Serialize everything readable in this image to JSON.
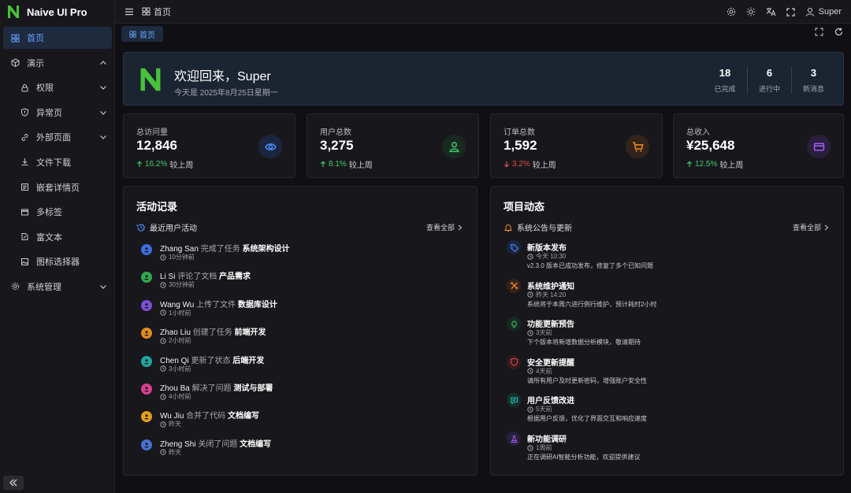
{
  "app": {
    "title": "Naive UI Pro"
  },
  "sidebar": {
    "items": [
      {
        "label": "首页",
        "icon": "dashboard-icon",
        "active": true,
        "sub": false
      },
      {
        "label": "演示",
        "icon": "cube-icon",
        "active": false,
        "sub": false,
        "chevron": "up"
      },
      {
        "label": "权限",
        "icon": "lock-icon",
        "active": false,
        "sub": true,
        "chevron": "down"
      },
      {
        "label": "异常页",
        "icon": "shield-alert-icon",
        "active": false,
        "sub": true,
        "chevron": "down"
      },
      {
        "label": "外部页面",
        "icon": "link-icon",
        "active": false,
        "sub": true,
        "chevron": "down"
      },
      {
        "label": "文件下载",
        "icon": "download-icon",
        "active": false,
        "sub": true
      },
      {
        "label": "嵌套详情页",
        "icon": "document-icon",
        "active": false,
        "sub": true
      },
      {
        "label": "多标签",
        "icon": "window-icon",
        "active": false,
        "sub": true
      },
      {
        "label": "富文本",
        "icon": "file-edit-icon",
        "active": false,
        "sub": true
      },
      {
        "label": "图标选择器",
        "icon": "image-icon",
        "active": false,
        "sub": true
      },
      {
        "label": "系统管理",
        "icon": "gear-icon",
        "active": false,
        "sub": false,
        "chevron": "down"
      }
    ]
  },
  "header": {
    "breadcrumb": "首页",
    "user": "Super"
  },
  "tabs": [
    {
      "label": "首页"
    }
  ],
  "welcome": {
    "title": "欢迎回来，Super",
    "subtitle": "今天是 2025年8月25日星期一",
    "stats": [
      {
        "value": "18",
        "label": "已完成"
      },
      {
        "value": "6",
        "label": "进行中"
      },
      {
        "value": "3",
        "label": "新消息"
      }
    ]
  },
  "stats": [
    {
      "label": "总访问量",
      "value": "12,846",
      "change": "16.2%",
      "direction": "up",
      "suffix": "较上周",
      "icon": "eye-icon",
      "color": "#4c8dff",
      "bg": "#1c2540"
    },
    {
      "label": "用户总数",
      "value": "3,275",
      "change": "8.1%",
      "direction": "up",
      "suffix": "较上周",
      "icon": "user-icon",
      "color": "#3fca6a",
      "bg": "#182a20"
    },
    {
      "label": "订单总数",
      "value": "1,592",
      "change": "3.2%",
      "direction": "down",
      "suffix": "较上周",
      "icon": "cart-icon",
      "color": "#f08a24",
      "bg": "#34231a"
    },
    {
      "label": "总收入",
      "value": "¥25,648",
      "change": "12.5%",
      "direction": "up",
      "suffix": "较上周",
      "icon": "card-icon",
      "color": "#a05cf0",
      "bg": "#2a1f3c"
    }
  ],
  "activity": {
    "title": "活动记录",
    "subtitle": "最近用户活动",
    "view_all": "查看全部",
    "items": [
      {
        "name": "Zhang San",
        "action": "完成了任务",
        "target": "系统架构设计",
        "time": "10分钟前",
        "color": "#3b6fe0"
      },
      {
        "name": "Li Si",
        "action": "评论了文档",
        "target": "产品需求",
        "time": "30分钟前",
        "color": "#2fa84f"
      },
      {
        "name": "Wang Wu",
        "action": "上传了文件",
        "target": "数据库设计",
        "time": "1小时前",
        "color": "#7a4fd6"
      },
      {
        "name": "Zhao Liu",
        "action": "创建了任务",
        "target": "前端开发",
        "time": "2小时前",
        "color": "#e08a1e"
      },
      {
        "name": "Chen Qi",
        "action": "更新了状态",
        "target": "后端开发",
        "time": "3小时前",
        "color": "#1fa6a0"
      },
      {
        "name": "Zhou Ba",
        "action": "解决了问题",
        "target": "测试与部署",
        "time": "4小时前",
        "color": "#d63f8e"
      },
      {
        "name": "Wu Jiu",
        "action": "合并了代码",
        "target": "文档编写",
        "time": "昨天",
        "color": "#e0a01e"
      },
      {
        "name": "Zheng Shi",
        "action": "关闭了问题",
        "target": "文档编写",
        "time": "昨天",
        "color": "#4a6fd0"
      }
    ]
  },
  "news": {
    "title": "项目动态",
    "subtitle": "系统公告与更新",
    "view_all": "查看全部",
    "items": [
      {
        "title": "新版本发布",
        "time": "今天 10:30",
        "desc": "v2.3.0 版本已成功发布，修复了多个已知问题",
        "icon": "tag-icon",
        "color": "#4c8dff",
        "bg": "#1c2540"
      },
      {
        "title": "系统维护通知",
        "time": "昨天 14:20",
        "desc": "系统将于本周六进行例行维护，预计耗时2小时",
        "icon": "tools-icon",
        "color": "#f08a24",
        "bg": "#34231a"
      },
      {
        "title": "功能更新预告",
        "time": "3天前",
        "desc": "下个版本将新增数据分析模块，敬请期待",
        "icon": "bulb-icon",
        "color": "#3fca6a",
        "bg": "#182a20"
      },
      {
        "title": "安全更新提醒",
        "time": "4天前",
        "desc": "请所有用户及时更新密码，增强账户安全性",
        "icon": "shield-icon",
        "color": "#e5484d",
        "bg": "#351b1e"
      },
      {
        "title": "用户反馈改进",
        "time": "5天前",
        "desc": "根据用户反馈，优化了界面交互和响应速度",
        "icon": "chat-icon",
        "color": "#1fc0b0",
        "bg": "#16302c"
      },
      {
        "title": "新功能调研",
        "time": "1周前",
        "desc": "正在调研AI智能分析功能，欢迎提供建议",
        "icon": "flask-icon",
        "color": "#a05cf0",
        "bg": "#2a1f3c"
      }
    ]
  }
}
